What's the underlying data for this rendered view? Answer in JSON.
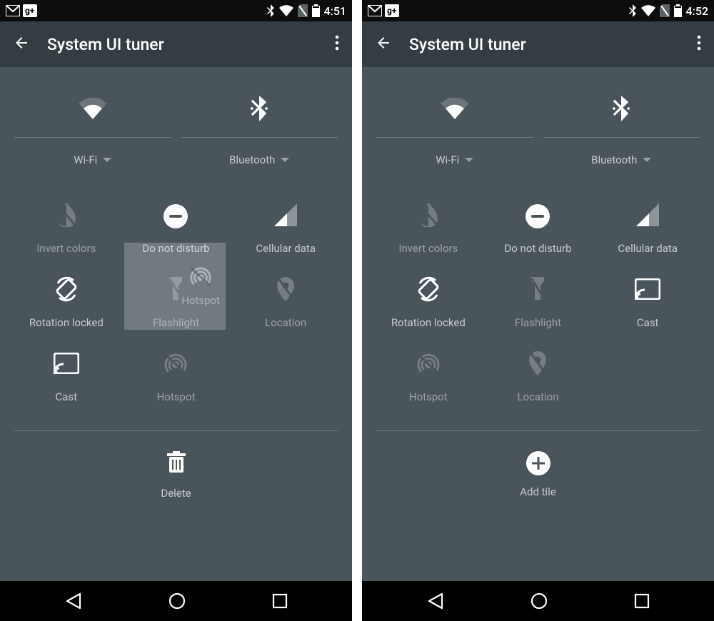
{
  "left": {
    "status_time": "4:51",
    "appbar_title": "System UI tuner",
    "top_tiles": [
      {
        "label": "Wi-Fi"
      },
      {
        "label": "Bluetooth"
      }
    ],
    "grid": [
      {
        "label": "Invert colors"
      },
      {
        "label": "Do not disturb"
      },
      {
        "label": "Cellular data"
      },
      {
        "label": "Rotation locked"
      },
      {
        "label": "Flashlight"
      },
      {
        "label": "Location"
      },
      {
        "label": "Cast"
      },
      {
        "label": "Hotspot"
      }
    ],
    "drag_ghost_label": "Hotspot",
    "bottom_label": "Delete"
  },
  "right": {
    "status_time": "4:52",
    "appbar_title": "System UI tuner",
    "top_tiles": [
      {
        "label": "Wi-Fi"
      },
      {
        "label": "Bluetooth"
      }
    ],
    "grid": [
      {
        "label": "Invert colors"
      },
      {
        "label": "Do not disturb"
      },
      {
        "label": "Cellular data"
      },
      {
        "label": "Rotation locked"
      },
      {
        "label": "Flashlight"
      },
      {
        "label": "Cast"
      },
      {
        "label": "Hotspot"
      },
      {
        "label": "Location"
      }
    ],
    "bottom_label": "Add tile"
  }
}
